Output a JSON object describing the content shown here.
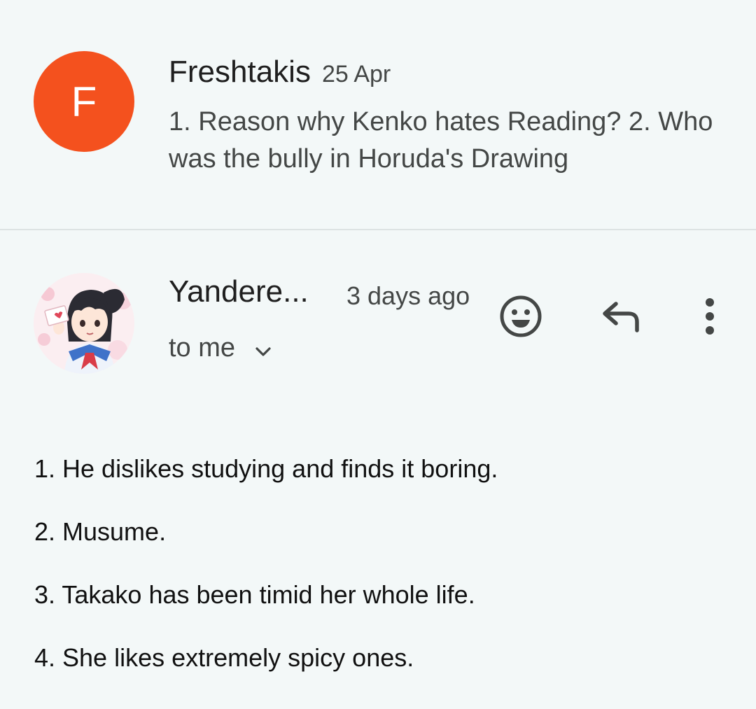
{
  "colors": {
    "background": "#f3f8f8",
    "avatar_f": "#f4511e",
    "icon": "#444746"
  },
  "thread_previous": {
    "avatar_letter": "F",
    "sender": "Freshtakis",
    "date": "25 Apr",
    "snippet": "1. Reason why Kenko hates Reading? 2. Who was the bully in Horuda's Drawing"
  },
  "thread_current": {
    "avatar_icon": "anime-girl-avatar",
    "sender": "Yandere...",
    "time": "3 days ago",
    "recipient_label": "to me",
    "actions": {
      "emoji_icon": "emoji-reaction-icon",
      "reply_icon": "reply-icon",
      "more_icon": "more-vert-icon"
    },
    "body_lines": [
      "1. He dislikes studying and finds it boring.",
      "2. Musume.",
      "3. Takako has been timid her whole life.",
      "4. She likes extremely spicy ones."
    ]
  }
}
